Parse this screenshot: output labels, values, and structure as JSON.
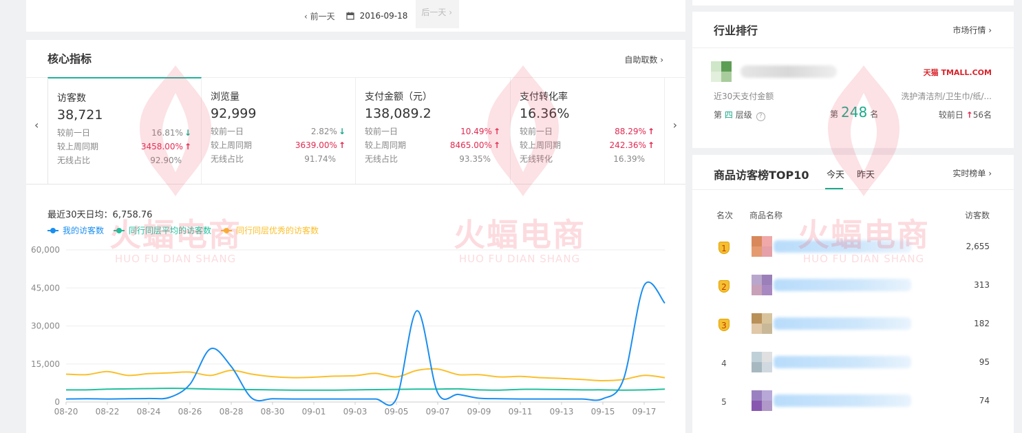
{
  "date_nav": {
    "prev": "前一天",
    "date": "2016-09-18",
    "next": "后一天"
  },
  "core": {
    "title": "核心指标",
    "link": "自助取数",
    "metrics": [
      {
        "name": "访客数",
        "value": "38,721",
        "rows": [
          {
            "label": "较前一日",
            "value": "16.81%",
            "dir": "down"
          },
          {
            "label": "较上周同期",
            "value": "3458.00%",
            "dir": "up"
          },
          {
            "label": "无线占比",
            "value": "92.90%",
            "dir": ""
          }
        ]
      },
      {
        "name": "浏览量",
        "value": "92,999",
        "rows": [
          {
            "label": "较前一日",
            "value": "2.82%",
            "dir": "down"
          },
          {
            "label": "较上周同期",
            "value": "3639.00%",
            "dir": "up"
          },
          {
            "label": "无线占比",
            "value": "91.74%",
            "dir": ""
          }
        ]
      },
      {
        "name": "支付金额（元）",
        "value": "138,089.2",
        "rows": [
          {
            "label": "较前一日",
            "value": "10.49%",
            "dir": "up"
          },
          {
            "label": "较上周同期",
            "value": "8465.00%",
            "dir": "up"
          },
          {
            "label": "无线占比",
            "value": "93.35%",
            "dir": ""
          }
        ]
      },
      {
        "name": "支付转化率",
        "value": "16.36%",
        "rows": [
          {
            "label": "较前一日",
            "value": "88.29%",
            "dir": "up"
          },
          {
            "label": "较上周同期",
            "value": "242.36%",
            "dir": "up"
          },
          {
            "label": "无线转化",
            "value": "16.39%",
            "dir": ""
          }
        ]
      }
    ],
    "avg_label": "最近30天日均：6,758.76"
  },
  "chart_data": {
    "type": "line",
    "x": [
      "08-20",
      "08-21",
      "08-22",
      "08-23",
      "08-24",
      "08-25",
      "08-26",
      "08-27",
      "08-28",
      "08-29",
      "08-30",
      "08-31",
      "09-01",
      "09-02",
      "09-03",
      "09-04",
      "09-05",
      "09-06",
      "09-07",
      "09-08",
      "09-09",
      "09-10",
      "09-11",
      "09-12",
      "09-13",
      "09-14",
      "09-15",
      "09-16",
      "09-17",
      "09-18"
    ],
    "xticks": [
      "08-20",
      "08-22",
      "08-24",
      "08-26",
      "08-28",
      "08-30",
      "09-01",
      "09-03",
      "09-05",
      "09-07",
      "09-09",
      "09-11",
      "09-13",
      "09-15",
      "09-17"
    ],
    "yticks": [
      "0",
      "15,000",
      "30,000",
      "45,000",
      "60,000"
    ],
    "ylim": [
      0,
      60000
    ],
    "series": [
      {
        "name": "我的访客数",
        "color": "#1a8ef0",
        "values": [
          1200,
          1300,
          1200,
          1300,
          1400,
          1800,
          7000,
          21000,
          14000,
          1500,
          1300,
          1200,
          1200,
          1200,
          1200,
          1200,
          1300,
          36000,
          3600,
          3000,
          1500,
          1300,
          1200,
          1200,
          1200,
          1200,
          1300,
          9000,
          46000,
          39000
        ]
      },
      {
        "name": "同行同层平均的访客数",
        "color": "#1fbf9c",
        "values": [
          4800,
          4800,
          5100,
          5200,
          5300,
          5400,
          5300,
          5100,
          5000,
          4900,
          4800,
          4700,
          4700,
          4700,
          4800,
          4900,
          5000,
          5100,
          5100,
          5200,
          4800,
          4700,
          5000,
          5000,
          4900,
          4800,
          4800,
          4700,
          4800,
          5100
        ]
      },
      {
        "name": "同行同层优秀的访客数",
        "color": "#fbbf2a",
        "values": [
          11000,
          10800,
          12000,
          10500,
          11200,
          11500,
          11800,
          10500,
          12500,
          11000,
          10000,
          9600,
          9800,
          10200,
          10400,
          11300,
          9900,
          12500,
          13000,
          10800,
          10800,
          9900,
          10100,
          9600,
          9300,
          8900,
          8400,
          8900,
          10500,
          9600
        ]
      }
    ]
  },
  "rank": {
    "title": "行业排行",
    "link": "市场行情",
    "tmall_logo": "天猫 TMALL.COM",
    "sub_left": "近30天支付金额",
    "sub_right": "洗护清洁剂/卫生巾/纸/...",
    "tier_prefix": "第",
    "tier_num": "四",
    "tier_suffix": "层级",
    "help": "?",
    "pos_prefix": "第",
    "pos_num": "248",
    "pos_suffix": "名",
    "cmp_label": "较前日",
    "cmp_value": "56名"
  },
  "top10": {
    "title": "商品访客榜TOP10",
    "tab_today": "今天",
    "tab_yesterday": "昨天",
    "link": "实时榜单",
    "headers": {
      "rank": "名次",
      "name": "商品名称",
      "visitors": "访客数"
    },
    "rows": [
      {
        "rank": "1",
        "visitors": "2,655"
      },
      {
        "rank": "2",
        "visitors": "313"
      },
      {
        "rank": "3",
        "visitors": "182"
      },
      {
        "rank": "4",
        "visitors": "95"
      },
      {
        "rank": "5",
        "visitors": "74"
      }
    ]
  },
  "watermark": {
    "cn": "火蝠电商",
    "en": "HUO FU DIAN SHANG"
  }
}
